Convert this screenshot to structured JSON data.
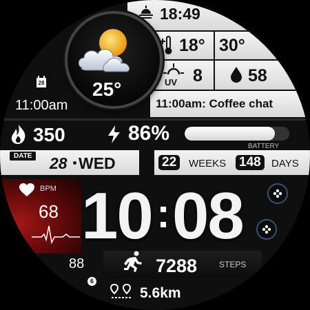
{
  "top": {
    "time": "18:49",
    "temp_low": "18°",
    "temp_high": "30°",
    "uv": "8",
    "humidity": "58"
  },
  "weather": {
    "temperature": "25°"
  },
  "calendar": {
    "day_badge": "28",
    "event_time": "11:00am",
    "event": "11:00am: Coffee chat"
  },
  "stats": {
    "calories": "350",
    "battery_percent": "86%",
    "battery_label": "BATTERY",
    "battery_level": 0.86
  },
  "date": {
    "label": "DATE",
    "day": "28",
    "weekday": "WED",
    "weeks_value": "22",
    "weeks_label": "WEEKS",
    "days_value": "148",
    "days_label": "DAYS"
  },
  "heart": {
    "label": "BPM",
    "value": "68"
  },
  "time": {
    "hours": "10",
    "minutes": "08"
  },
  "steps": {
    "value": "7288",
    "label": "STEPS"
  },
  "bottom": {
    "notif_value": "88",
    "notif_badge": "6",
    "distance": "5.6km"
  },
  "colors": {
    "heart_bg": "#8a1010",
    "accent": "#ffffff"
  }
}
